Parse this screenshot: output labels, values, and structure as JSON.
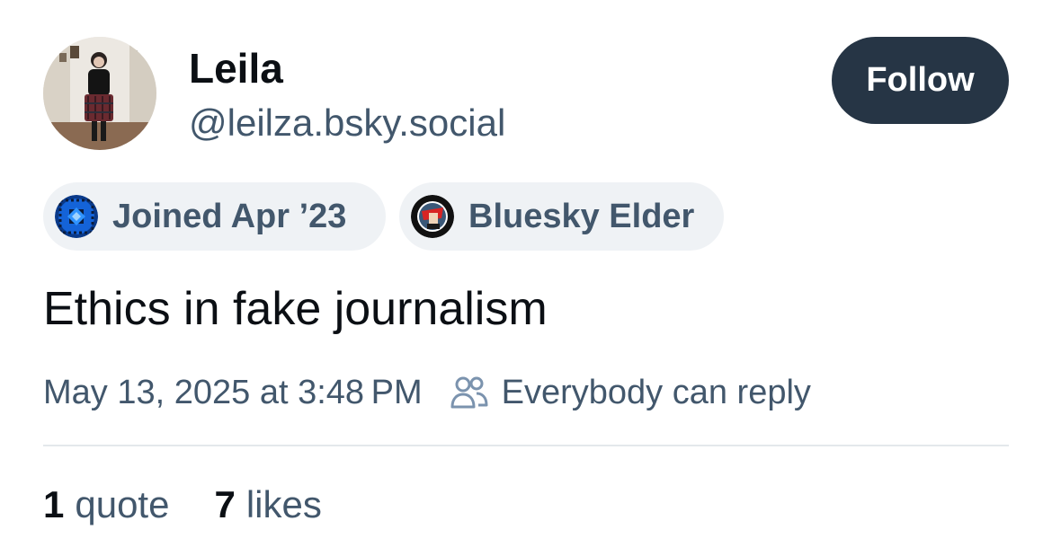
{
  "author": {
    "display_name": "Leila",
    "handle": "@leilza.bsky.social",
    "avatar_icon": "user-avatar-photo"
  },
  "follow": {
    "label": "Follow",
    "background": "#263545"
  },
  "badges": [
    {
      "label": "Joined Apr ’23",
      "icon": "join-date-badge-icon"
    },
    {
      "label": "Bluesky Elder",
      "icon": "bluesky-elder-badge-icon"
    }
  ],
  "post": {
    "text": "Ethics in fake journalism",
    "timestamp": "May 13, 2025 at 3:48 PM",
    "reply_setting": "Everybody can reply",
    "reply_icon": "people-icon"
  },
  "stats": [
    {
      "count": "1",
      "label": "quote"
    },
    {
      "count": "7",
      "label": "likes"
    }
  ],
  "colors": {
    "text_primary": "#0b0f14",
    "text_secondary": "#42576c",
    "pill_background": "#eff2f5",
    "divider": "#e4e8ec"
  }
}
